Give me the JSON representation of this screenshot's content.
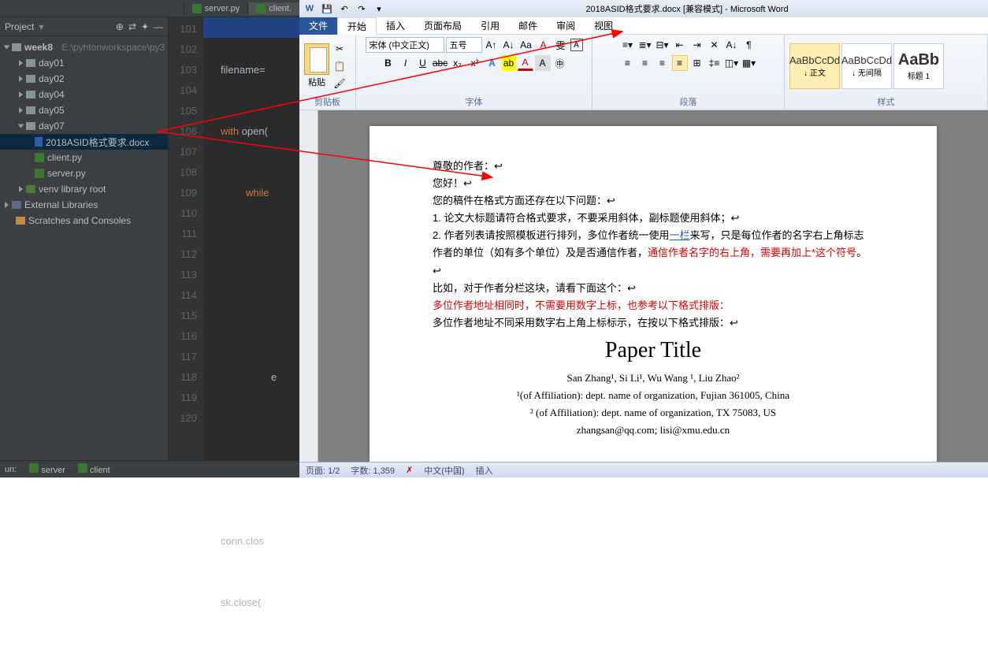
{
  "ide": {
    "project_label": "Project",
    "tabs": [
      {
        "name": "server.py",
        "active": false
      },
      {
        "name": "client.",
        "active": true
      }
    ],
    "tree": {
      "root": "week8",
      "root_path": "E:\\pyhtonworkspace\\py3",
      "folders": [
        "day01",
        "day02",
        "day04",
        "day05",
        "day07"
      ],
      "day07_files": [
        "2018ASID格式要求.docx",
        "client.py",
        "server.py"
      ],
      "venv": "venv  library root",
      "ext": "External Libraries",
      "scratches": "Scratches and Consoles"
    },
    "gutter": [
      "101",
      "102",
      "103",
      "104",
      "105",
      "106",
      "107",
      "108",
      "109",
      "110",
      "111",
      "112",
      "113",
      "114",
      "115",
      "116",
      "117",
      "118",
      "119",
      "120"
    ],
    "code": {
      "l1": "filename=",
      "l2_kw": "with ",
      "l2": "open(",
      "l3_kw": "while",
      "l3": "",
      "l4": "e",
      "l5": "conn.clos",
      "l6": "sk.close("
    },
    "bottom": {
      "run": "un:",
      "server": "server",
      "client": "client"
    }
  },
  "word": {
    "title": "2018ASID格式要求.docx [兼容模式] - Microsoft Word",
    "tabs": {
      "file": "文件",
      "home": "开始",
      "insert": "插入",
      "layout": "页面布局",
      "ref": "引用",
      "mail": "邮件",
      "review": "审阅",
      "view": "视图"
    },
    "groups": {
      "clipboard": "剪贴板",
      "font": "字体",
      "para": "段落",
      "styles": "样式"
    },
    "paste": "粘贴",
    "font_name": "宋体 (中文正文)",
    "font_size": "五号",
    "styles": [
      {
        "prev": "AaBbCcDd",
        "name": "↓ 正文"
      },
      {
        "prev": "AaBbCcDd",
        "name": "↓ 无间隔"
      },
      {
        "prev": "AaBb",
        "name": "标题 1"
      }
    ],
    "doc": {
      "l1": "尊敬的作者：↩",
      "l2": "您好！↩",
      "l3": "您的稿件在格式方面还存在以下问题：↩",
      "l4": "1.     论文大标题请符合格式要求，不要采用斜体，副标题使用斜体；↩",
      "l5a": "2.     作者列表请按照模板进行排列，多位作者统一使用",
      "l5link": "一栏",
      "l5b": "来写，只是每位作者的名字右上角标志作者的单位（如有多个单位）及是否通信作者，",
      "l5red": "通信作者名字的右上角，需要再加上*这个符号",
      "l5c": "。↩",
      "l6": "比如，对于作者分栏这块，请看下面这个：↩",
      "l7": "多位作者地址相同时，不需要用数字上标，也参考以下格式排版：",
      "l8": "多位作者地址不同采用数字右上角上标标示，在按以下格式排版：↩",
      "title": "Paper Title",
      "authors_html": "San Zhang¹, Si Li¹, Wu Wang ¹, Liu Zhao²",
      "aff1": "¹(of Affiliation): dept. name of organization, Fujian 361005, China",
      "aff2": "² (of Affiliation): dept. name of organization, TX 75083, US",
      "email": "zhangsan@qq.com; lisi@xmu.edu.cn"
    },
    "status": {
      "page": "页面: 1/2",
      "words": "字数: 1,359",
      "lang": "中文(中国)",
      "ins": "插入"
    }
  }
}
